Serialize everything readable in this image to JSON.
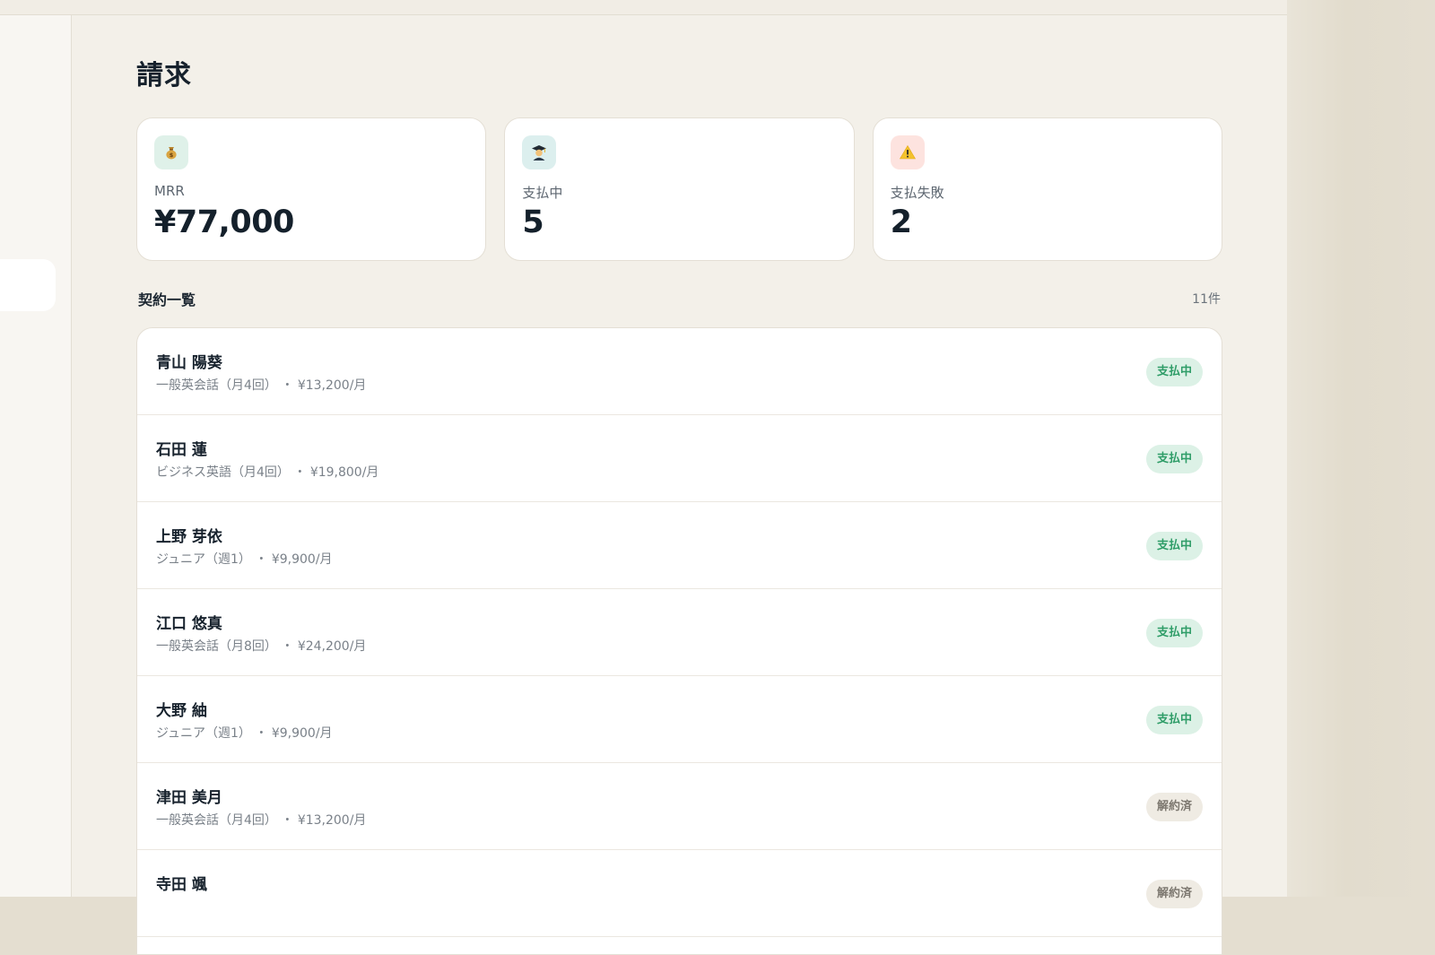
{
  "page": {
    "title": "請求"
  },
  "stats": [
    {
      "icon": "money-bag-icon",
      "label": "MRR",
      "value": "¥77,000",
      "accent": "#dff1e9"
    },
    {
      "icon": "student-icon",
      "label": "支払中",
      "value": "5",
      "accent": "#dcefee"
    },
    {
      "icon": "warning-icon",
      "label": "支払失敗",
      "value": "2",
      "accent": "#fde3df"
    }
  ],
  "contracts": {
    "title": "契約一覧",
    "count": "11件",
    "rows": [
      {
        "name": "青山 陽葵",
        "plan": "一般英会話（月4回）",
        "price": "・ ¥13,200/月",
        "status": "支払中"
      },
      {
        "name": "石田 蓮",
        "plan": "ビジネス英語（月4回）",
        "price": "・ ¥19,800/月",
        "status": "支払中"
      },
      {
        "name": "上野 芽依",
        "plan": "ジュニア（週1）",
        "price": "・ ¥9,900/月",
        "status": "支払中"
      },
      {
        "name": "江口 悠真",
        "plan": "一般英会話（月8回）",
        "price": "・ ¥24,200/月",
        "status": "支払中"
      },
      {
        "name": "大野 紬",
        "plan": "ジュニア（週1）",
        "price": "・ ¥9,900/月",
        "status": "支払中"
      },
      {
        "name": "津田 美月",
        "plan": "一般英会話（月4回）",
        "price": "・ ¥13,200/月",
        "status": "解約済"
      },
      {
        "name": "寺田 颯",
        "plan": "",
        "price": "",
        "status": "解約済"
      }
    ]
  },
  "colors": {
    "active_badge_bg": "#dcf1e6",
    "active_badge_text": "#2f9d68",
    "cancel_badge_bg": "#efebe3",
    "cancel_badge_text": "#7d7870"
  }
}
